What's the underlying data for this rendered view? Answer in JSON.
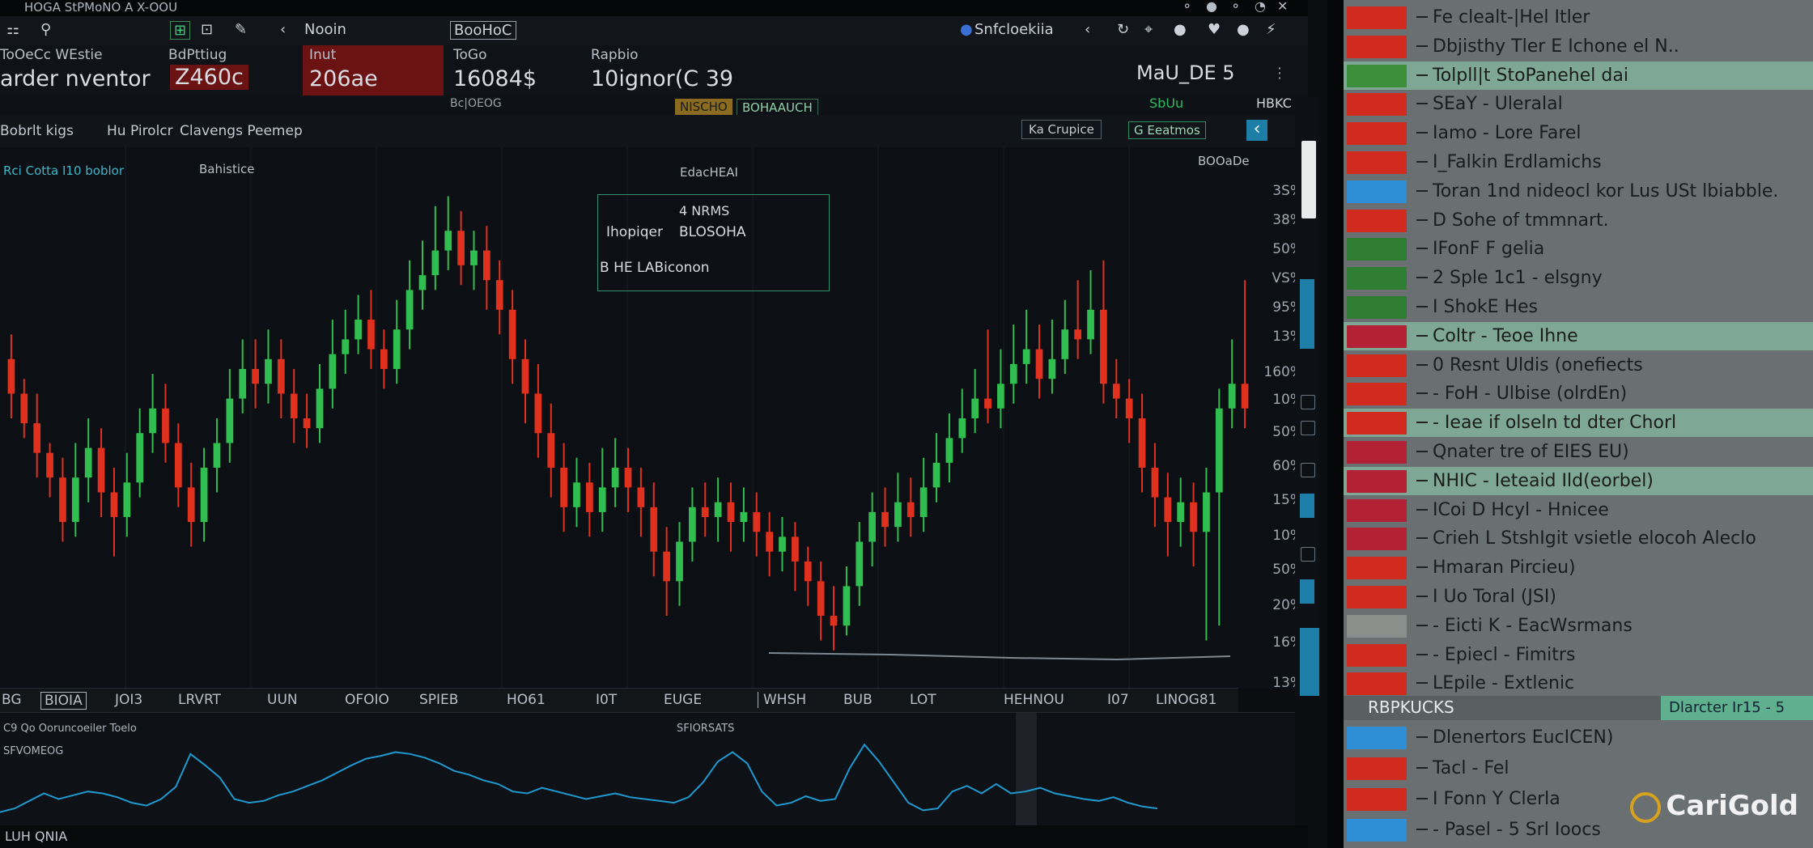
{
  "window": {
    "title": "HOGA StPMoNO A X-OOU"
  },
  "menubar": {
    "items": [
      "Nooin",
      "BooHoC",
      "Snfcloekiia"
    ]
  },
  "quote": {
    "cells": [
      {
        "label": "ToOeCc WEstie",
        "value": "arder nventor",
        "style": "plain"
      },
      {
        "label": "BdPttiug",
        "value": "Z460c",
        "style": "red"
      },
      {
        "label": "Inut",
        "value": "206ae",
        "style": "red"
      },
      {
        "label": "ToGo",
        "value": "16084$",
        "style": "plain"
      },
      {
        "label": "Rapbio",
        "value": "10ignor(C 39",
        "style": "plain"
      }
    ],
    "right_label": "MaU_DE 5",
    "sub_left": "Bc|OEOG",
    "sub_badge": "NISCHO",
    "sub_badge2": "BOHAAUCH",
    "sub_right": "SbUu",
    "sub_right2": "HBKC"
  },
  "toolbar": {
    "items": [
      "Bobrlt kigs",
      "Hu Pirolcr",
      "Clavengs Peemep"
    ],
    "right_button": "Ka Crupice",
    "right_badge": "G Eeatmos"
  },
  "chart": {
    "legend_line1": "Rci Cotta I10 boblor",
    "legend_line2": "Bahistice",
    "tooltip_title": "EdacHEAI",
    "tooltip_row1": "4 NRMS",
    "tooltip_row2_label": "Ihopiqer",
    "tooltip_row2_value": "BLOSOHA",
    "tooltip_row3": "B HE LABiconon",
    "axis_title": "BOOaDe",
    "y_ticks": [
      "3S%",
      "38%",
      "50%",
      "VS%",
      "95%",
      "13%",
      "160%",
      "10%",
      "50%",
      "60%",
      "15%",
      "10%",
      "50%",
      "20%",
      "16%",
      "13%"
    ],
    "colors": {
      "up": "#2fbe4f",
      "down": "#e0311f",
      "wick_up": "#2fbe4f",
      "wick_down": "#e0311f",
      "baseline": "#7f8791"
    }
  },
  "chart_data": {
    "type": "line",
    "title": "",
    "x": [],
    "series": [],
    "ylim": [
      0,
      100
    ]
  },
  "candles": [
    {
      "o": 62,
      "c": 55,
      "h": 67,
      "l": 50
    },
    {
      "o": 55,
      "c": 49,
      "h": 58,
      "l": 46
    },
    {
      "o": 49,
      "c": 43,
      "h": 55,
      "l": 38
    },
    {
      "o": 43,
      "c": 38,
      "h": 45,
      "l": 34
    },
    {
      "o": 38,
      "c": 29,
      "h": 42,
      "l": 25
    },
    {
      "o": 29,
      "c": 38,
      "h": 45,
      "l": 26
    },
    {
      "o": 38,
      "c": 44,
      "h": 50,
      "l": 33
    },
    {
      "o": 44,
      "c": 35,
      "h": 48,
      "l": 30
    },
    {
      "o": 35,
      "c": 30,
      "h": 40,
      "l": 22
    },
    {
      "o": 30,
      "c": 37,
      "h": 43,
      "l": 26
    },
    {
      "o": 37,
      "c": 47,
      "h": 52,
      "l": 34
    },
    {
      "o": 47,
      "c": 52,
      "h": 59,
      "l": 43
    },
    {
      "o": 52,
      "c": 45,
      "h": 57,
      "l": 41
    },
    {
      "o": 45,
      "c": 36,
      "h": 49,
      "l": 32
    },
    {
      "o": 36,
      "c": 29,
      "h": 41,
      "l": 24
    },
    {
      "o": 29,
      "c": 40,
      "h": 44,
      "l": 25
    },
    {
      "o": 40,
      "c": 45,
      "h": 50,
      "l": 35
    },
    {
      "o": 45,
      "c": 54,
      "h": 60,
      "l": 41
    },
    {
      "o": 54,
      "c": 60,
      "h": 66,
      "l": 51
    },
    {
      "o": 60,
      "c": 57,
      "h": 66,
      "l": 52
    },
    {
      "o": 57,
      "c": 62,
      "h": 68,
      "l": 53
    },
    {
      "o": 62,
      "c": 55,
      "h": 66,
      "l": 50
    },
    {
      "o": 55,
      "c": 50,
      "h": 60,
      "l": 45
    },
    {
      "o": 50,
      "c": 48,
      "h": 55,
      "l": 44
    },
    {
      "o": 48,
      "c": 56,
      "h": 61,
      "l": 45
    },
    {
      "o": 56,
      "c": 63,
      "h": 70,
      "l": 52
    },
    {
      "o": 63,
      "c": 66,
      "h": 72,
      "l": 59
    },
    {
      "o": 66,
      "c": 70,
      "h": 75,
      "l": 63
    },
    {
      "o": 70,
      "c": 64,
      "h": 76,
      "l": 60
    },
    {
      "o": 64,
      "c": 60,
      "h": 68,
      "l": 56
    },
    {
      "o": 60,
      "c": 68,
      "h": 74,
      "l": 57
    },
    {
      "o": 68,
      "c": 76,
      "h": 82,
      "l": 64
    },
    {
      "o": 76,
      "c": 79,
      "h": 86,
      "l": 72
    },
    {
      "o": 79,
      "c": 84,
      "h": 93,
      "l": 76
    },
    {
      "o": 84,
      "c": 88,
      "h": 95,
      "l": 80
    },
    {
      "o": 88,
      "c": 81,
      "h": 92,
      "l": 77
    },
    {
      "o": 81,
      "c": 84,
      "h": 88,
      "l": 76
    },
    {
      "o": 84,
      "c": 78,
      "h": 89,
      "l": 72
    },
    {
      "o": 78,
      "c": 72,
      "h": 82,
      "l": 67
    },
    {
      "o": 72,
      "c": 62,
      "h": 76,
      "l": 57
    },
    {
      "o": 62,
      "c": 55,
      "h": 66,
      "l": 49
    },
    {
      "o": 55,
      "c": 47,
      "h": 61,
      "l": 42
    },
    {
      "o": 47,
      "c": 40,
      "h": 53,
      "l": 34
    },
    {
      "o": 40,
      "c": 32,
      "h": 45,
      "l": 27
    },
    {
      "o": 32,
      "c": 37,
      "h": 42,
      "l": 28
    },
    {
      "o": 37,
      "c": 31,
      "h": 41,
      "l": 26
    },
    {
      "o": 31,
      "c": 36,
      "h": 44,
      "l": 27
    },
    {
      "o": 36,
      "c": 40,
      "h": 46,
      "l": 32
    },
    {
      "o": 40,
      "c": 36,
      "h": 44,
      "l": 31
    },
    {
      "o": 36,
      "c": 32,
      "h": 40,
      "l": 26
    },
    {
      "o": 32,
      "c": 23,
      "h": 37,
      "l": 18
    },
    {
      "o": 23,
      "c": 17,
      "h": 28,
      "l": 10
    },
    {
      "o": 17,
      "c": 25,
      "h": 29,
      "l": 12
    },
    {
      "o": 25,
      "c": 32,
      "h": 36,
      "l": 21
    },
    {
      "o": 32,
      "c": 30,
      "h": 37,
      "l": 26
    },
    {
      "o": 30,
      "c": 33,
      "h": 38,
      "l": 25
    },
    {
      "o": 33,
      "c": 29,
      "h": 37,
      "l": 23
    },
    {
      "o": 29,
      "c": 31,
      "h": 36,
      "l": 25
    },
    {
      "o": 31,
      "c": 27,
      "h": 35,
      "l": 22
    },
    {
      "o": 27,
      "c": 23,
      "h": 31,
      "l": 18
    },
    {
      "o": 23,
      "c": 26,
      "h": 30,
      "l": 19
    },
    {
      "o": 26,
      "c": 21,
      "h": 29,
      "l": 15
    },
    {
      "o": 21,
      "c": 17,
      "h": 24,
      "l": 12
    },
    {
      "o": 17,
      "c": 10,
      "h": 21,
      "l": 5
    },
    {
      "o": 10,
      "c": 8,
      "h": 16,
      "l": 3
    },
    {
      "o": 8,
      "c": 16,
      "h": 20,
      "l": 6
    },
    {
      "o": 16,
      "c": 25,
      "h": 29,
      "l": 12
    },
    {
      "o": 25,
      "c": 31,
      "h": 35,
      "l": 20
    },
    {
      "o": 31,
      "c": 28,
      "h": 36,
      "l": 24
    },
    {
      "o": 28,
      "c": 33,
      "h": 39,
      "l": 25
    },
    {
      "o": 33,
      "c": 30,
      "h": 38,
      "l": 26
    },
    {
      "o": 30,
      "c": 36,
      "h": 42,
      "l": 27
    },
    {
      "o": 36,
      "c": 41,
      "h": 47,
      "l": 33
    },
    {
      "o": 41,
      "c": 46,
      "h": 51,
      "l": 37
    },
    {
      "o": 46,
      "c": 50,
      "h": 56,
      "l": 43
    },
    {
      "o": 50,
      "c": 54,
      "h": 60,
      "l": 47
    },
    {
      "o": 54,
      "c": 52,
      "h": 68,
      "l": 49
    },
    {
      "o": 52,
      "c": 57,
      "h": 64,
      "l": 48
    },
    {
      "o": 57,
      "c": 61,
      "h": 69,
      "l": 53
    },
    {
      "o": 61,
      "c": 64,
      "h": 72,
      "l": 57
    },
    {
      "o": 64,
      "c": 58,
      "h": 69,
      "l": 54
    },
    {
      "o": 58,
      "c": 62,
      "h": 70,
      "l": 55
    },
    {
      "o": 62,
      "c": 68,
      "h": 74,
      "l": 59
    },
    {
      "o": 68,
      "c": 66,
      "h": 78,
      "l": 62
    },
    {
      "o": 66,
      "c": 72,
      "h": 80,
      "l": 63
    },
    {
      "o": 72,
      "c": 57,
      "h": 82,
      "l": 53
    },
    {
      "o": 57,
      "c": 54,
      "h": 62,
      "l": 50
    },
    {
      "o": 54,
      "c": 50,
      "h": 58,
      "l": 45
    },
    {
      "o": 50,
      "c": 40,
      "h": 55,
      "l": 35
    },
    {
      "o": 40,
      "c": 34,
      "h": 45,
      "l": 28
    },
    {
      "o": 34,
      "c": 29,
      "h": 39,
      "l": 22
    },
    {
      "o": 29,
      "c": 33,
      "h": 38,
      "l": 24
    },
    {
      "o": 33,
      "c": 27,
      "h": 37,
      "l": 20
    },
    {
      "o": 27,
      "c": 35,
      "h": 40,
      "l": 5
    },
    {
      "o": 35,
      "c": 52,
      "h": 56,
      "l": 8
    },
    {
      "o": 52,
      "c": 57,
      "h": 66,
      "l": 48
    },
    {
      "o": 57,
      "c": 52,
      "h": 78,
      "l": 48
    }
  ],
  "timeline": {
    "labels": [
      "BG",
      "BIOIA",
      "JOI3",
      "LRVRT",
      "UUN",
      "OFOIO",
      "SPIEB",
      "HO61",
      "I0T",
      "EUGE",
      "WHSH",
      "BUB",
      "LOT",
      "HEHNOU",
      "I07",
      "LINOG81"
    ]
  },
  "oscillator": {
    "legend1": "C9 Qo Ooruncoeiler Toelo",
    "legend2": "SFVOMEOG",
    "legend3": "SFIORSATS",
    "values": [
      8,
      12,
      20,
      28,
      22,
      26,
      30,
      28,
      24,
      18,
      15,
      22,
      35,
      70,
      58,
      45,
      22,
      18,
      20,
      26,
      30,
      36,
      42,
      50,
      58,
      65,
      68,
      72,
      70,
      66,
      60,
      52,
      48,
      42,
      38,
      30,
      28,
      34,
      30,
      26,
      22,
      25,
      28,
      24,
      22,
      20,
      18,
      24,
      40,
      62,
      72,
      60,
      30,
      15,
      18,
      25,
      20,
      22,
      55,
      80,
      62,
      40,
      18,
      10,
      12,
      30,
      36,
      28,
      38,
      28,
      30,
      34,
      28,
      25,
      22,
      20,
      24,
      18,
      14,
      12
    ],
    "color": "#1e9ad1"
  },
  "statusbar": {
    "left": "LUH QNIA"
  },
  "right_panel": {
    "brand": "CariGold",
    "rows": [
      {
        "flag": "#d12a1f",
        "text": "Fe clealt-|Hel Itler",
        "hl": false
      },
      {
        "flag": "#d12a1f",
        "text": "Dbjisthy Tler E Ichone el N..",
        "hl": false
      },
      {
        "flag": "#3e8f3b",
        "text": "Tolpll|t StoPanehel dai",
        "hl": true
      },
      {
        "flag": "#d12a1f",
        "text": "SEaY - Uleralal",
        "hl": false
      },
      {
        "flag": "#d12a1f",
        "text": "Iamo - Lore Farel",
        "hl": false
      },
      {
        "flag": "#d12a1f",
        "text": "I_Falkin Erdlamichs",
        "hl": false
      },
      {
        "flag": "#2f8fd6",
        "text": "Toran 1nd nideocl kor Lus USt lbiabble.",
        "hl": false
      },
      {
        "flag": "#d12a1f",
        "text": "D Sohe of tmmnart.",
        "hl": false
      },
      {
        "flag": "#2e7d32",
        "text": "IFonF F gelia",
        "hl": false
      },
      {
        "flag": "#2e7d32",
        "text": "2 Sple 1c1 - elsgny",
        "hl": false
      },
      {
        "flag": "#2e7d32",
        "text": "I ShokE Hes",
        "hl": false
      },
      {
        "flag": "#b22234",
        "text": "Coltr - Teoe Ihne",
        "hl": true
      },
      {
        "flag": "#d12a1f",
        "text": "0 Resnt Uldis (onefiects",
        "hl": false
      },
      {
        "flag": "#d12a1f",
        "text": "- FoH - Ulbise (olrdEn)",
        "hl": false
      },
      {
        "flag": "#d12a1f",
        "text": "- Ieae if olseln td dter Chorl",
        "hl": true
      },
      {
        "flag": "#b22234",
        "text": "Qnater tre of EIES EU)",
        "hl": false
      },
      {
        "flag": "#b22234",
        "text": "NHIC - Ieteaid Ild(eorbel)",
        "hl": true
      },
      {
        "flag": "#b22234",
        "text": "ICoi D Hcyl - Hnicee",
        "hl": false
      },
      {
        "flag": "#b22234",
        "text": "Crieh L StshIgit vsietle elocoh Aleclo",
        "hl": false
      },
      {
        "flag": "#d12a1f",
        "text": "Hmaran Pircieu)",
        "hl": false
      },
      {
        "flag": "#d12a1f",
        "text": "I Uo Toral (JSI)",
        "hl": false
      },
      {
        "flag": "#8a8f8c",
        "text": "- Eicti K - EacWsrmans",
        "hl": false
      },
      {
        "flag": "#d12a1f",
        "text": "- Epiecl - Fimitrs",
        "hl": false
      },
      {
        "flag": "#d12a1f",
        "text": "LEpile - Extlenic",
        "hl": false
      }
    ],
    "section_header": "RBPKUCKS",
    "section_header_right": "Dlarcter Ir15 - 5",
    "rows2": [
      {
        "flag": "#2f8fd6",
        "text": "Dlenertors EucICEN)",
        "hl": false
      },
      {
        "flag": "#d12a1f",
        "text": "Tacl - Fel",
        "hl": false
      },
      {
        "flag": "#d12a1f",
        "text": "I Fonn Y Clerla",
        "hl": false
      },
      {
        "flag": "#2f8fd6",
        "text": "- Pasel - 5 Srl Ioocs",
        "hl": false
      }
    ]
  }
}
